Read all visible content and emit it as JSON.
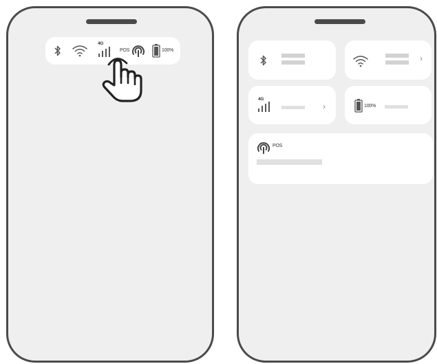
{
  "status_bar": {
    "network_type": "4G",
    "pos_label": "POS",
    "battery_level": "100%"
  },
  "control_center": {
    "cellular_tile": {
      "network_type": "4G"
    },
    "battery_tile": {
      "battery_level": "100%"
    },
    "pos_tile": {
      "label": "POS"
    }
  },
  "icons": [
    "bluetooth-icon",
    "wifi-icon",
    "cellular-signal-icon",
    "pos-nfc-icon",
    "battery-icon",
    "tap-hand-cursor-icon",
    "chevron-right-icon"
  ],
  "colors": {
    "frame": "#4a4a4a",
    "screen": "#efefef",
    "tile": "#ffffff",
    "placeholder": "#e0e0e0"
  }
}
